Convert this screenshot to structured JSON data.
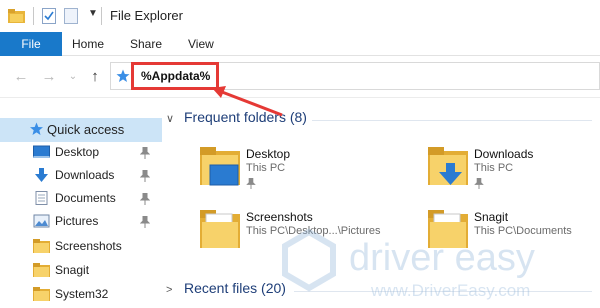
{
  "window": {
    "title": "File Explorer"
  },
  "ribbon": {
    "tabs": [
      {
        "label": "File",
        "active": true
      },
      {
        "label": "Home"
      },
      {
        "label": "Share"
      },
      {
        "label": "View"
      }
    ]
  },
  "address_bar": {
    "value": "%Appdata%"
  },
  "nav_pane": {
    "quick_access": {
      "label": "Quick access",
      "icon": "star-icon"
    },
    "items": [
      {
        "label": "Desktop",
        "icon": "desktop-icon",
        "pinned": true
      },
      {
        "label": "Downloads",
        "icon": "download-icon",
        "pinned": true
      },
      {
        "label": "Documents",
        "icon": "documents-icon",
        "pinned": true
      },
      {
        "label": "Pictures",
        "icon": "pictures-icon",
        "pinned": true
      },
      {
        "label": "Screenshots",
        "icon": "folder-icon",
        "pinned": false
      },
      {
        "label": "Snagit",
        "icon": "folder-icon",
        "pinned": false
      },
      {
        "label": "System32",
        "icon": "folder-icon",
        "pinned": false
      }
    ]
  },
  "frequent_folders": {
    "header": "Frequent folders (8)",
    "items": [
      {
        "name": "Desktop",
        "location": "This PC",
        "pinned": true
      },
      {
        "name": "Downloads",
        "location": "This PC",
        "pinned": true
      },
      {
        "name": "Screenshots",
        "location": "This PC\\Desktop...\\Pictures",
        "pinned": false
      },
      {
        "name": "Snagit",
        "location": "This PC\\Documents",
        "pinned": false
      }
    ]
  },
  "recent_files": {
    "header": "Recent files (20)"
  },
  "watermark": {
    "brand": "driver easy",
    "url": "www.DriverEasy.com"
  },
  "colors": {
    "accent": "#1979ca",
    "highlight": "#e53935",
    "selection": "#cce4f7",
    "section_text": "#1e3e78"
  }
}
